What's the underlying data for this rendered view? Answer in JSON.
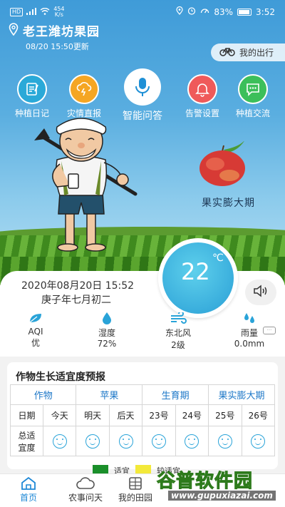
{
  "status": {
    "network": "HD",
    "net_speed": "454",
    "net_unit": "K/s",
    "battery": "83%",
    "time": "3:52"
  },
  "location": {
    "name": "老王潍坊果园",
    "updated": "08/20 15:50更新"
  },
  "trip_label": "我的出行",
  "toolbar": [
    {
      "label": "种植日记",
      "color": "#2aa9d8"
    },
    {
      "label": "灾情直报",
      "color": "#f5a623"
    },
    {
      "label": "智能问答",
      "color": "#1e90d6"
    },
    {
      "label": "告警设置",
      "color": "#ef5a5a"
    },
    {
      "label": "种植交流",
      "color": "#3cbf5a"
    }
  ],
  "growth_stage": "果实膨大期",
  "weather": {
    "temperature": "22",
    "unit": "℃",
    "date": "2020年08月20日 15:52",
    "lunar": "庚子年七月初二",
    "stats": [
      {
        "icon": "leaf-icon",
        "label": "AQI",
        "value": "优"
      },
      {
        "icon": "droplet-icon",
        "label": "湿度",
        "value": "72%"
      },
      {
        "icon": "wind-icon",
        "label": "东北风",
        "value": "2级"
      },
      {
        "icon": "rain-icon",
        "label": "雨量",
        "value": "0.0mm"
      }
    ],
    "more": "···"
  },
  "forecast": {
    "title": "作物生长适宜度预报",
    "crop_label": "作物",
    "crop_value": "苹果",
    "period_label": "生育期",
    "period_value": "果实膨大期",
    "date_label": "日期",
    "days": [
      "今天",
      "明天",
      "后天",
      "23号",
      "24号",
      "25号",
      "26号"
    ],
    "score_label_1": "总适",
    "score_label_2": "宜度",
    "legend": [
      "适宜",
      "较适宜"
    ],
    "legend_colors": {
      "suitable": "#1a8f2a",
      "fair": "#f3e93a"
    }
  },
  "nav": [
    {
      "label": "首页",
      "active": true
    },
    {
      "label": "农事问天",
      "active": false
    },
    {
      "label": "我的田园",
      "active": false
    }
  ],
  "watermark": {
    "main": "谷普软件园",
    "url": "www.gupuxiazai.com"
  },
  "colors": {
    "accent": "#1e88d6",
    "sky": "#4ea6dd"
  }
}
